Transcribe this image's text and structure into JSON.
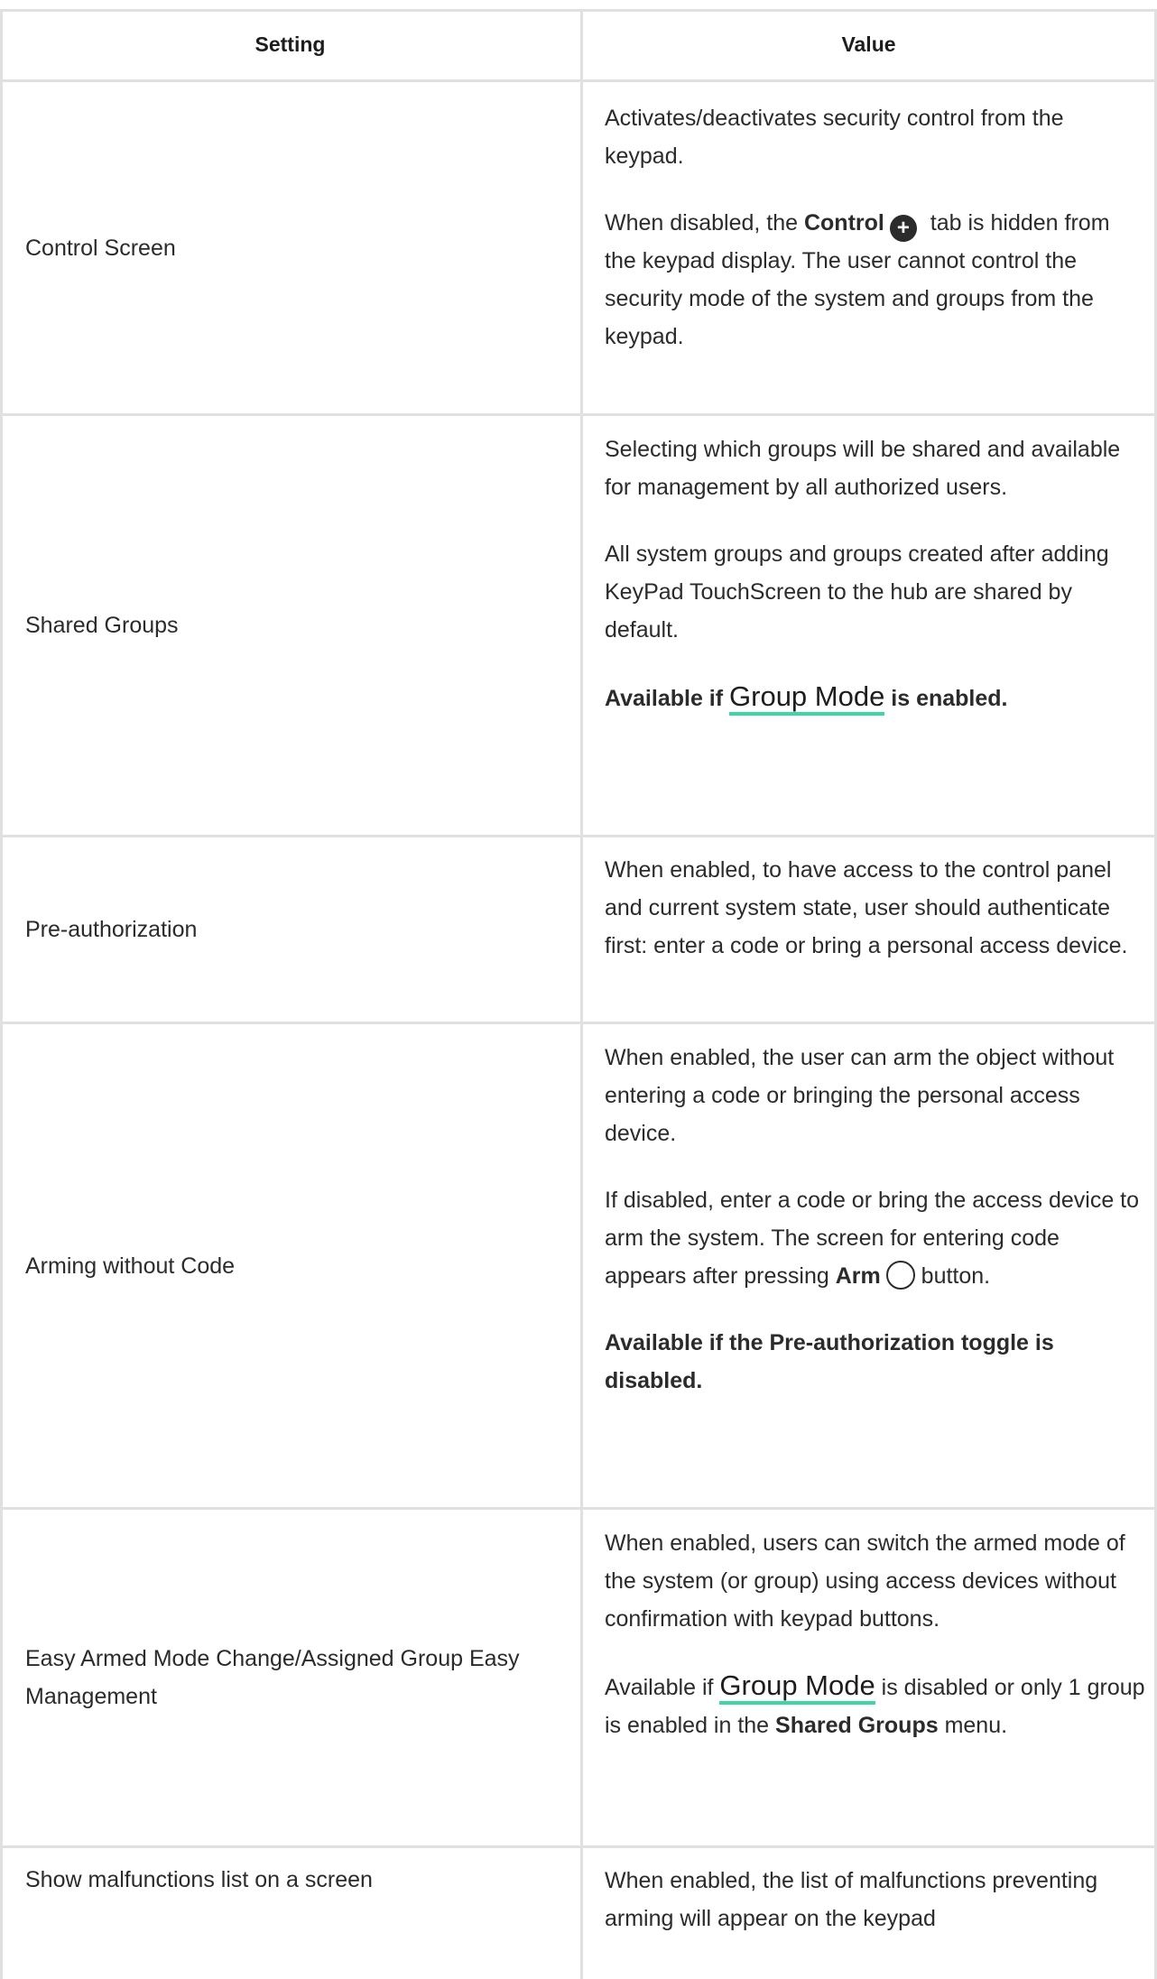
{
  "header": {
    "col_setting": "Setting",
    "col_value": "Value"
  },
  "rows": [
    {
      "setting": "Control Screen",
      "p1": "Activates/deactivates security control from the keypad.",
      "p2_a": "When disabled, the ",
      "p2_bold": "Control",
      "p2_b": " tab is hidden from the keypad display. The user cannot control the security mode of the system and groups from the keypad."
    },
    {
      "setting": "Shared Groups",
      "p1": "Selecting which groups will be shared and available for management by all authorized users.",
      "p2": "All system groups and groups created after adding KeyPad TouchScreen to the hub are shared by default.",
      "p3_a": "Available if ",
      "p3_link": "Group Mode",
      "p3_b": " is enabled."
    },
    {
      "setting": "Pre-authorization",
      "p1": "When enabled, to have access to the control panel and current system state, user should authenticate first: enter a code or bring a personal access device."
    },
    {
      "setting": "Arming without Code",
      "p1": "When enabled, the user can arm the object without entering a code or bringing the personal access device.",
      "p2_a": "If disabled, enter a code or bring the access device to arm the system. The screen for entering code appears after pressing ",
      "p2_bold": "Arm",
      "p2_b": " button.",
      "p3": "Available if the Pre-authorization toggle is disabled."
    },
    {
      "setting": "Easy Armed Mode Change/Assigned Group Easy Management",
      "p1": "When enabled, users can switch the armed mode of the system (or group) using access devices without confirmation with keypad buttons.",
      "p2_a": "Available if ",
      "p2_link": "Group Mode",
      "p2_b": " is disabled or only 1 group is enabled in the ",
      "p2_bold": "Shared Groups",
      "p2_c": " menu."
    },
    {
      "setting": "Show malfunctions list on a screen",
      "p1": "When enabled, the list of malfunctions preventing arming will appear on the keypad"
    }
  ],
  "icons": {
    "control": "plus-circle-icon",
    "arm": "circle-outline-icon"
  },
  "colors": {
    "link_underline": "#3ed6a4",
    "border": "#e0e0e0"
  }
}
